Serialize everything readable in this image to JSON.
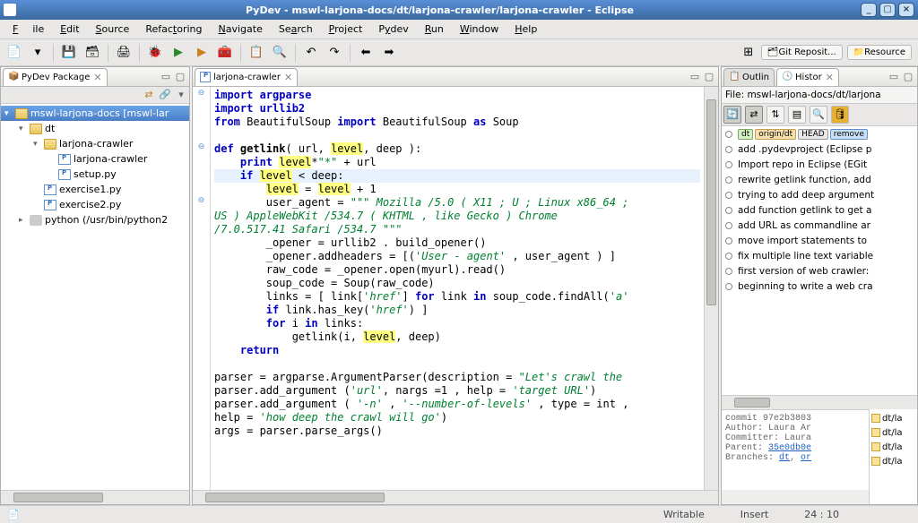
{
  "window": {
    "title": "PyDev - mswl-larjona-docs/dt/larjona-crawler/larjona-crawler - Eclipse"
  },
  "menu": {
    "file": "File",
    "edit": "Edit",
    "source": "Source",
    "refactor": "Refactoring",
    "navigate": "Navigate",
    "search": "Search",
    "project": "Project",
    "pydev": "Pydev",
    "run": "Run",
    "window": "Window",
    "help": "Help"
  },
  "perspectives": {
    "git": "Git Reposit...",
    "resource": "Resource"
  },
  "package_view": {
    "title": "PyDev Package",
    "project": "mswl-larjona-docs [mswl-lar",
    "nodes": {
      "dt": "dt",
      "crawler_folder": "larjona-crawler",
      "crawler_file": "larjona-crawler",
      "setup": "setup.py",
      "ex1": "exercise1.py",
      "ex2": "exercise2.py",
      "python": "python  (/usr/bin/python2"
    }
  },
  "editor": {
    "tab": "larjona-crawler",
    "lines": {
      "l1": "import argparse",
      "l2": "import urllib2",
      "l3a": "from ",
      "l3b": "BeautifulSoup ",
      "l3c": "import ",
      "l3d": "BeautifulSoup ",
      "l3e": "as ",
      "l3f": "Soup",
      "l5a": "def ",
      "l5b": "getlink",
      "l5c": "( url, ",
      "l5d": "level",
      "l5e": ", deep ):",
      "l6a": "    print ",
      "l6b": "level",
      "l6c": "*",
      "l6d": "\"*\"",
      "l6e": " + url",
      "l7a": "    if ",
      "l7b": "level",
      "l7c": " < deep:",
      "l8a": "        ",
      "l8b": "level",
      "l8c": " = ",
      "l8d": "level",
      "l8e": " + 1",
      "l9a": "        user_agent = ",
      "l9b": "\"\"\" Mozilla /5.0 ( X11 ; U ; Linux x86_64 ; ",
      "l10": "US ) AppleWebKit /534.7 ( KHTML , like Gecko ) Chrome ",
      "l11": "/7.0.517.41 Safari /534.7 \"\"\"",
      "l12": "        _opener = urllib2 . build_opener()",
      "l13a": "        _opener.addheaders = [(",
      "l13b": "'User - agent'",
      "l13c": " , user_agent ) ]",
      "l14": "        raw_code = _opener.open(myurl).read()",
      "l15": "        soup_code = Soup(raw_code)",
      "l16a": "        links = [ link[",
      "l16b": "'href'",
      "l16c": "] ",
      "l16d": "for",
      "l16e": " link ",
      "l16f": "in",
      "l16g": " soup_code.findAll(",
      "l16h": "'a'",
      "l17a": "        if",
      "l17b": " link.has_key(",
      "l17c": "'href'",
      "l17d": ") ]",
      "l18a": "        for",
      "l18b": " i ",
      "l18c": "in",
      "l18d": " links:",
      "l19a": "            getlink(i, ",
      "l19b": "level",
      "l19c": ", deep)",
      "l20": "    return",
      "l22a": "parser = argparse.ArgumentParser(description = ",
      "l22b": "\"Let's crawl the ",
      "l23a": "parser.add_argument (",
      "l23b": "'url'",
      "l23c": ", nargs =1 , help = ",
      "l23d": "'target URL'",
      "l23e": ")",
      "l24a": "parser.add_argument ( ",
      "l24b": "'-n'",
      "l24c": " , ",
      "l24d": "'--number-of-levels'",
      "l24e": " , type = int , ",
      "l25a": "help = ",
      "l25b": "'how deep the crawl will go'",
      "l25c": ")",
      "l26": "args = parser.parse_args()"
    }
  },
  "outline": {
    "title": "Outlin"
  },
  "history": {
    "title": "Histor",
    "file_label": "File: mswl-larjona-docs/dt/larjona",
    "commits": [
      {
        "tags": [
          {
            "cls": "branch-tag",
            "text": "dt"
          },
          {
            "cls": "branch-tag orange",
            "text": "origin/dt"
          },
          {
            "cls": "branch-tag head",
            "text": "HEAD"
          },
          {
            "cls": "branch-tag blue",
            "text": "remove"
          }
        ],
        "msg": ""
      },
      {
        "msg": "add .pydevproject (Eclipse p"
      },
      {
        "msg": "Import repo in Eclipse (EGit"
      },
      {
        "msg": "rewrite getlink function, add"
      },
      {
        "msg": "trying to add deep argument"
      },
      {
        "msg": "add function getlink to get a"
      },
      {
        "msg": "add URL as commandline ar"
      },
      {
        "msg": "move import statements to"
      },
      {
        "msg": "fix multiple line text variable"
      },
      {
        "msg": "first version of web crawler:"
      },
      {
        "msg": "beginning to write a web cra"
      }
    ],
    "detail": {
      "commit": "commit 97e2b3803",
      "author": "Author: Laura Ar",
      "committer": "Committer: Laura",
      "parent_lbl": "Parent: ",
      "parent_val": "35e0db0e",
      "branches_lbl": "Branches: ",
      "b1": "dt",
      "b2": "or"
    },
    "files": [
      "dt/la",
      "dt/la",
      "dt/la",
      "dt/la"
    ]
  },
  "status": {
    "writable": "Writable",
    "insert": "Insert",
    "pos": "24 : 10"
  }
}
